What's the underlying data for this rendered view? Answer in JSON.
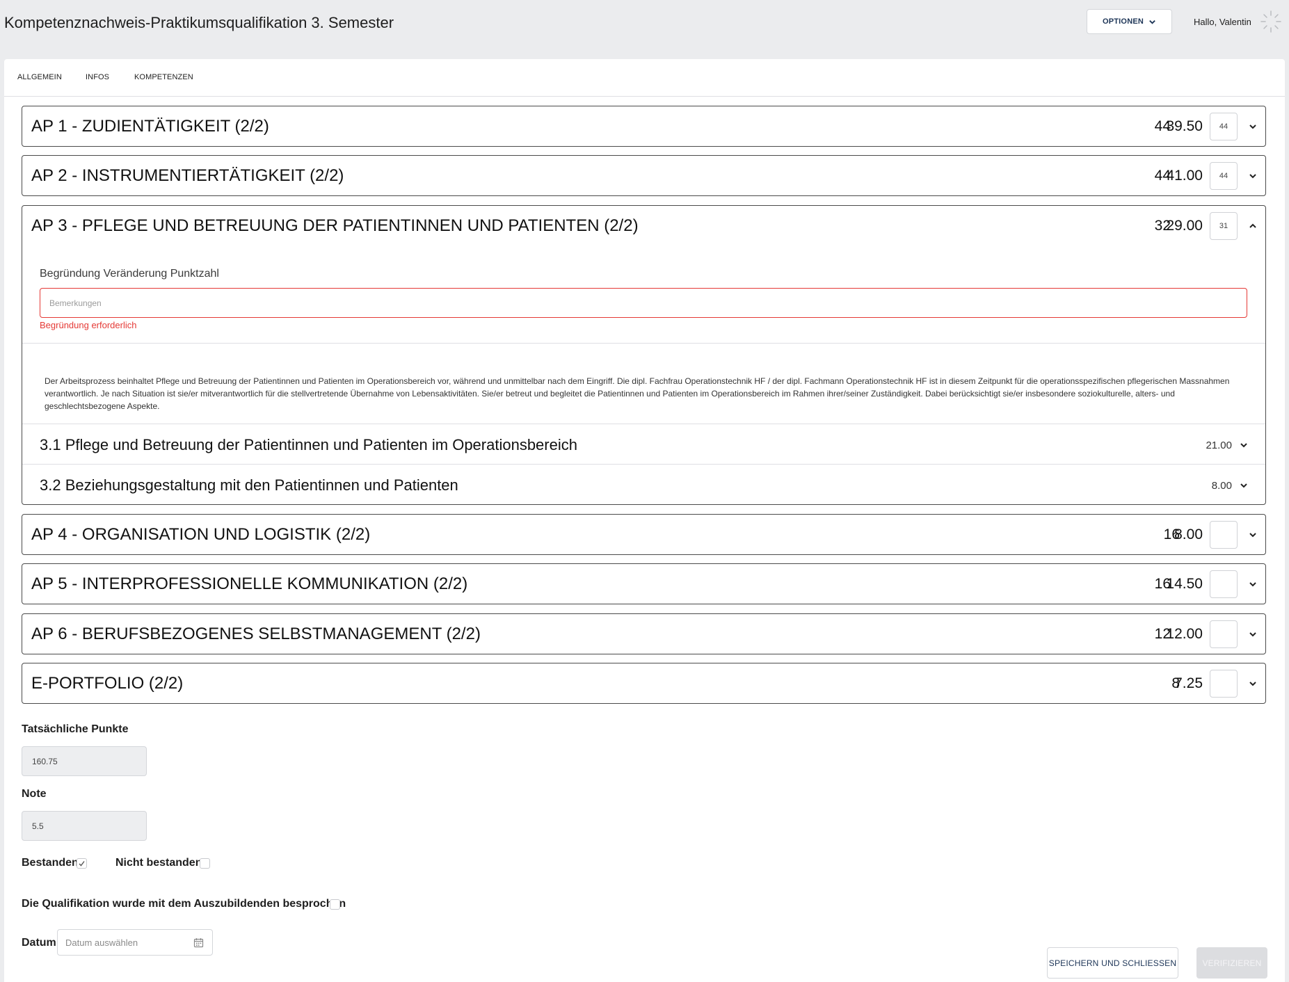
{
  "header": {
    "title": "Kompetenznachweis-Praktikumsqualifikation 3. Semester",
    "options_label": "OPTIONEN",
    "greeting": "Hallo, Valentin"
  },
  "tabs": [
    "ALLGEMEIN",
    "INFOS",
    "KOMPETENZEN"
  ],
  "panels": [
    {
      "title": "AP 1 - ZUDIENTÄTIGKEIT (2/2)",
      "max": "44",
      "score": "39.50",
      "input": "44",
      "expanded": false
    },
    {
      "title": "AP 2 - INSTRUMENTIERTÄTIGKEIT (2/2)",
      "max": "44",
      "score": "41.00",
      "input": "44",
      "expanded": false
    },
    {
      "title": "AP 3 - PFLEGE UND BETREUUNG DER PATIENTINNEN UND PATIENTEN (2/2)",
      "max": "32",
      "score": "29.00",
      "input": "31",
      "expanded": true,
      "reason_label": "Begründung Veränderung Punktzahl",
      "reason_placeholder": "Bemerkungen",
      "reason_error": "Begründung erforderlich",
      "description": "Der Arbeitsprozess beinhaltet Pflege und Betreuung der Patientinnen und Patienten im Operationsbereich vor, während und unmittelbar nach dem Eingriff. Die dipl. Fachfrau Operationstechnik HF / der dipl. Fachmann Operationstechnik HF ist in diesem Zeitpunkt für die operationsspezifischen pflegerischen Massnahmen verantwortlich. Je nach Situation ist sie/er mitverantwortlich für die stellvertretende Übernahme von Lebensaktivitäten. Sie/er betreut und begleitet die Patientinnen und Patienten im Operationsbereich im Rahmen ihrer/seiner Zuständigkeit. Dabei berücksichtigt sie/er insbesondere soziokulturelle, alters- und geschlechtsbezogene Aspekte.",
      "subsections": [
        {
          "title": "3.1 Pflege und Betreuung der Patientinnen und Patienten im Operationsbereich",
          "score": "21.00"
        },
        {
          "title": "3.2 Beziehungsgestaltung mit den Patientinnen und Patienten",
          "score": "8.00"
        }
      ]
    },
    {
      "title": "AP 4 - ORGANISATION UND LOGISTIK (2/2)",
      "max": "16",
      "score": "8.00",
      "input": "",
      "expanded": false
    },
    {
      "title": "AP 5 - INTERPROFESSIONELLE KOMMUNIKATION (2/2)",
      "max": "16",
      "score": "14.50",
      "input": "",
      "expanded": false
    },
    {
      "title": "AP 6 - BERUFSBEZOGENES SELBSTMANAGEMENT (2/2)",
      "max": "12",
      "score": "12.00",
      "input": "",
      "expanded": false
    },
    {
      "title": "E-PORTFOLIO (2/2)",
      "max": "8",
      "score": "7.25",
      "input": "",
      "expanded": false
    }
  ],
  "summary": {
    "actual_points_label": "Tatsächliche Punkte",
    "actual_points_value": "160.75",
    "grade_label": "Note",
    "grade_value": "5.5",
    "passed_label": "Bestanden",
    "passed_checked": true,
    "failed_label": "Nicht bestanden",
    "failed_checked": false,
    "discussed_label": "Die Qualifikation wurde mit dem Auszubildenden besprochen",
    "discussed_checked": false,
    "date_label": "Datum",
    "date_placeholder": "Datum auswählen"
  },
  "actions": {
    "save_label": "SPEICHERN UND SCHLIESSEN",
    "verify_label": "VERIFIZIEREN"
  },
  "colors": {
    "page_background": "#ebecee",
    "card_background": "#ffffff",
    "error": "#e53935",
    "primary_text": "#1d3557",
    "disabled_button": "#dcdde0"
  }
}
